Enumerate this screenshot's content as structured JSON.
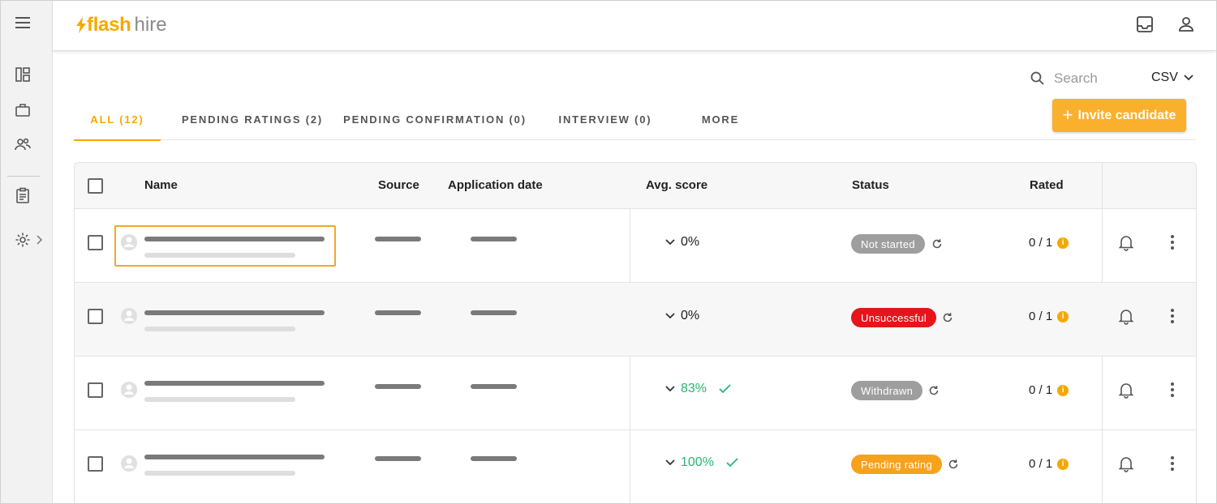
{
  "brand": {
    "flash": "flash",
    "hire": "hire",
    "accent": "#f5a800"
  },
  "sidebar": {
    "items": [
      {
        "icon": "menu-icon"
      },
      {
        "icon": "dashboard-icon"
      },
      {
        "icon": "briefcase-icon"
      },
      {
        "icon": "people-icon"
      },
      {
        "icon": "clipboard-icon"
      },
      {
        "icon": "gear-icon"
      }
    ]
  },
  "header": {
    "icons": [
      "inbox-icon",
      "user-icon"
    ]
  },
  "search": {
    "placeholder": "Search"
  },
  "export": {
    "label": "CSV"
  },
  "invite": {
    "plus": "+",
    "label": "Invite candidate"
  },
  "tabs": [
    {
      "label": "ALL (12)",
      "active": true
    },
    {
      "label": "PENDING RATINGS (2)"
    },
    {
      "label": "PENDING CONFIRMATION (0)"
    },
    {
      "label": "INTERVIEW (0)"
    },
    {
      "label": "MORE"
    }
  ],
  "table": {
    "columns": {
      "name": "Name",
      "source": "Source",
      "application_date": "Application date",
      "avg_score": "Avg. score",
      "status": "Status",
      "rated": "Rated"
    },
    "rows": [
      {
        "score": "0%",
        "status": "Not started",
        "status_color": "#9e9e9e",
        "rated": "0 / 1",
        "good": false
      },
      {
        "score": "0%",
        "status": "Unsuccessful",
        "status_color": "#e8141c",
        "rated": "0 / 1",
        "good": false
      },
      {
        "score": "83%",
        "status": "Withdrawn",
        "status_color": "#9e9e9e",
        "rated": "0 / 1",
        "good": true
      },
      {
        "score": "100%",
        "status": "Pending rating",
        "status_color": "#f7a21c",
        "rated": "0 / 1",
        "good": true
      }
    ]
  },
  "colors": {
    "good": "#2bb673",
    "info": "#f5a800"
  }
}
